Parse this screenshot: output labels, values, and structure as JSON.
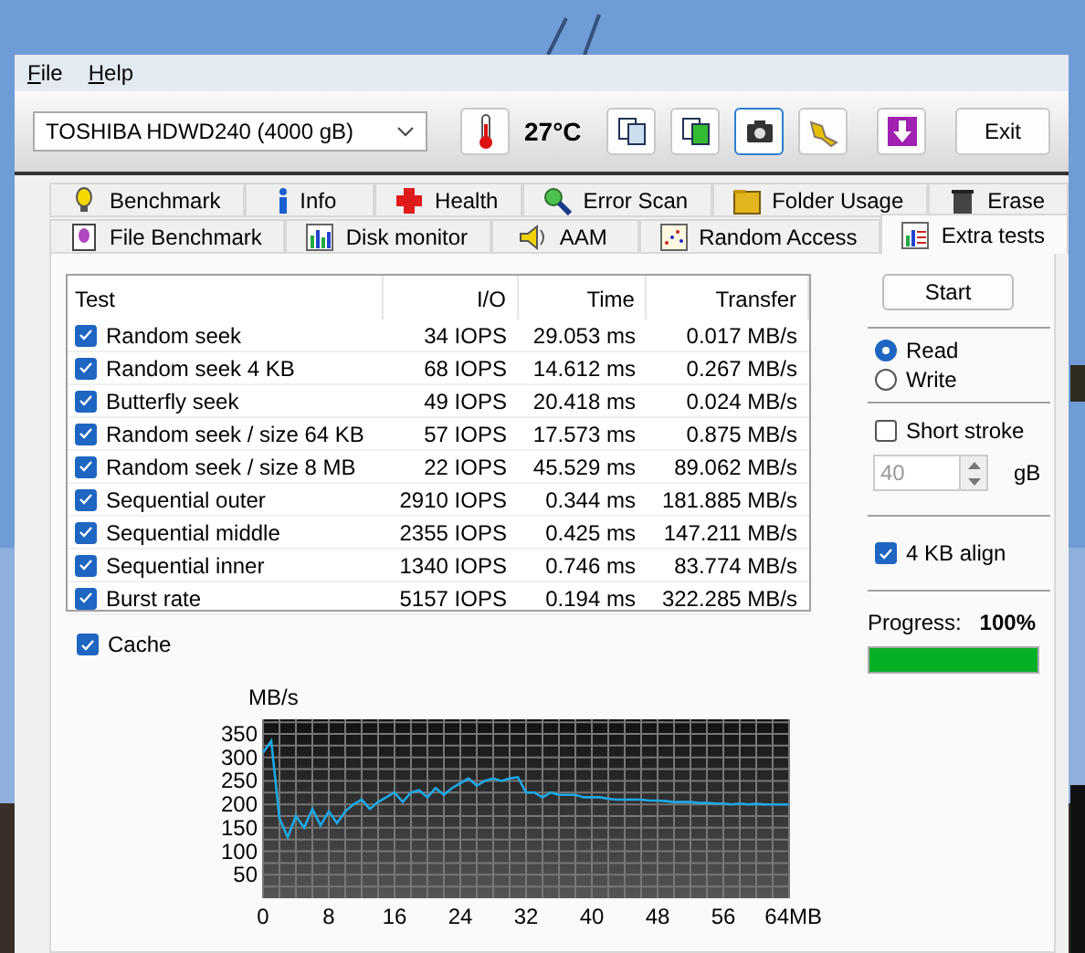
{
  "menu": [
    {
      "label": "File"
    },
    {
      "label": "Help"
    }
  ],
  "toolbar": {
    "drive": {
      "value": "TOSHIBA HDWD240 (4000 gB)"
    },
    "temperature": "27°C",
    "tool_buttons": [
      {
        "selected": false
      },
      {
        "selected": false
      },
      {
        "selected": true
      },
      {
        "selected": false
      },
      {
        "selected": false
      }
    ],
    "exit": "Exit"
  },
  "tabs": [
    [
      {
        "label": "Benchmark",
        "selected": false
      },
      {
        "label": "Info",
        "selected": false
      },
      {
        "label": "Health",
        "selected": false
      },
      {
        "label": "Error Scan",
        "selected": false
      },
      {
        "label": "Folder Usage",
        "selected": false
      },
      {
        "label": "Erase",
        "selected": false
      }
    ],
    [
      {
        "label": "File Benchmark",
        "selected": false
      },
      {
        "label": "Disk monitor",
        "selected": false
      },
      {
        "label": "AAM",
        "selected": false
      },
      {
        "label": "Random Access",
        "selected": false
      },
      {
        "label": "Extra tests",
        "selected": true
      }
    ]
  ],
  "table": {
    "columns": [
      "Test",
      "I/O",
      "Time",
      "Transfer"
    ],
    "rows": [
      {
        "checked": true,
        "test": "Random seek",
        "io": "34 IOPS",
        "time": "29.053 ms",
        "transfer": "0.017 MB/s"
      },
      {
        "checked": true,
        "test": "Random seek 4 KB",
        "io": "68 IOPS",
        "time": "14.612 ms",
        "transfer": "0.267 MB/s"
      },
      {
        "checked": true,
        "test": "Butterfly seek",
        "io": "49 IOPS",
        "time": "20.418 ms",
        "transfer": "0.024 MB/s"
      },
      {
        "checked": true,
        "test": "Random seek / size 64 KB",
        "io": "57 IOPS",
        "time": "17.573 ms",
        "transfer": "0.875 MB/s"
      },
      {
        "checked": true,
        "test": "Random seek / size 8 MB",
        "io": "22 IOPS",
        "time": "45.529 ms",
        "transfer": "89.062 MB/s"
      },
      {
        "checked": true,
        "test": "Sequential outer",
        "io": "2910 IOPS",
        "time": "0.344 ms",
        "transfer": "181.885 MB/s"
      },
      {
        "checked": true,
        "test": "Sequential middle",
        "io": "2355 IOPS",
        "time": "0.425 ms",
        "transfer": "147.211 MB/s"
      },
      {
        "checked": true,
        "test": "Sequential inner",
        "io": "1340 IOPS",
        "time": "0.746 ms",
        "transfer": "83.774 MB/s"
      },
      {
        "checked": true,
        "test": "Burst rate",
        "io": "5157 IOPS",
        "time": "0.194 ms",
        "transfer": "322.285 MB/s"
      }
    ]
  },
  "cache": {
    "label": "Cache",
    "checked": true
  },
  "side": {
    "start": "Start",
    "modes": [
      {
        "label": "Read",
        "selected": true
      },
      {
        "label": "Write",
        "selected": false
      }
    ],
    "short_stroke": {
      "label": "Short stroke",
      "checked": false
    },
    "stroke_size": {
      "value": "40",
      "unit": "gB",
      "disabled": true
    },
    "align": {
      "label": "4 KB align",
      "checked": true
    },
    "progress": {
      "label": "Progress:",
      "reading": "100%",
      "level": 1
    }
  },
  "chart": {
    "chart_data": {
      "type": "line",
      "ylabel": "MB/s",
      "xlabel": "MB",
      "grid": true,
      "xlim": [
        0,
        64
      ],
      "ylim": [
        0,
        350
      ],
      "xticks": [
        0,
        8,
        16,
        24,
        32,
        40,
        48,
        56,
        64
      ],
      "yticks": [
        50,
        100,
        150,
        200,
        250,
        300,
        350
      ],
      "x": [
        0,
        1,
        2,
        3,
        4,
        5,
        6,
        7,
        8,
        9,
        10,
        11,
        12,
        13,
        14,
        15,
        16,
        17,
        18,
        19,
        20,
        21,
        22,
        23,
        24,
        25,
        26,
        27,
        28,
        29,
        30,
        31,
        32,
        33,
        34,
        35,
        36,
        37,
        38,
        39,
        40,
        41,
        42,
        43,
        44,
        45,
        46,
        47,
        48,
        49,
        50,
        51,
        52,
        53,
        54,
        55,
        56,
        57,
        58,
        59,
        60,
        61,
        62,
        63,
        64
      ],
      "series": [
        {
          "color": "#1ea8e6",
          "values": [
            310,
            335,
            170,
            130,
            175,
            150,
            190,
            155,
            185,
            160,
            185,
            200,
            210,
            190,
            205,
            215,
            225,
            205,
            225,
            230,
            215,
            235,
            220,
            235,
            245,
            255,
            240,
            250,
            255,
            250,
            255,
            258,
            225,
            225,
            215,
            225,
            220,
            220,
            220,
            215,
            215,
            215,
            212,
            210,
            210,
            210,
            210,
            208,
            208,
            207,
            205,
            205,
            205,
            203,
            203,
            202,
            202,
            200,
            202,
            200,
            201,
            200,
            200,
            200,
            200
          ]
        }
      ]
    }
  }
}
